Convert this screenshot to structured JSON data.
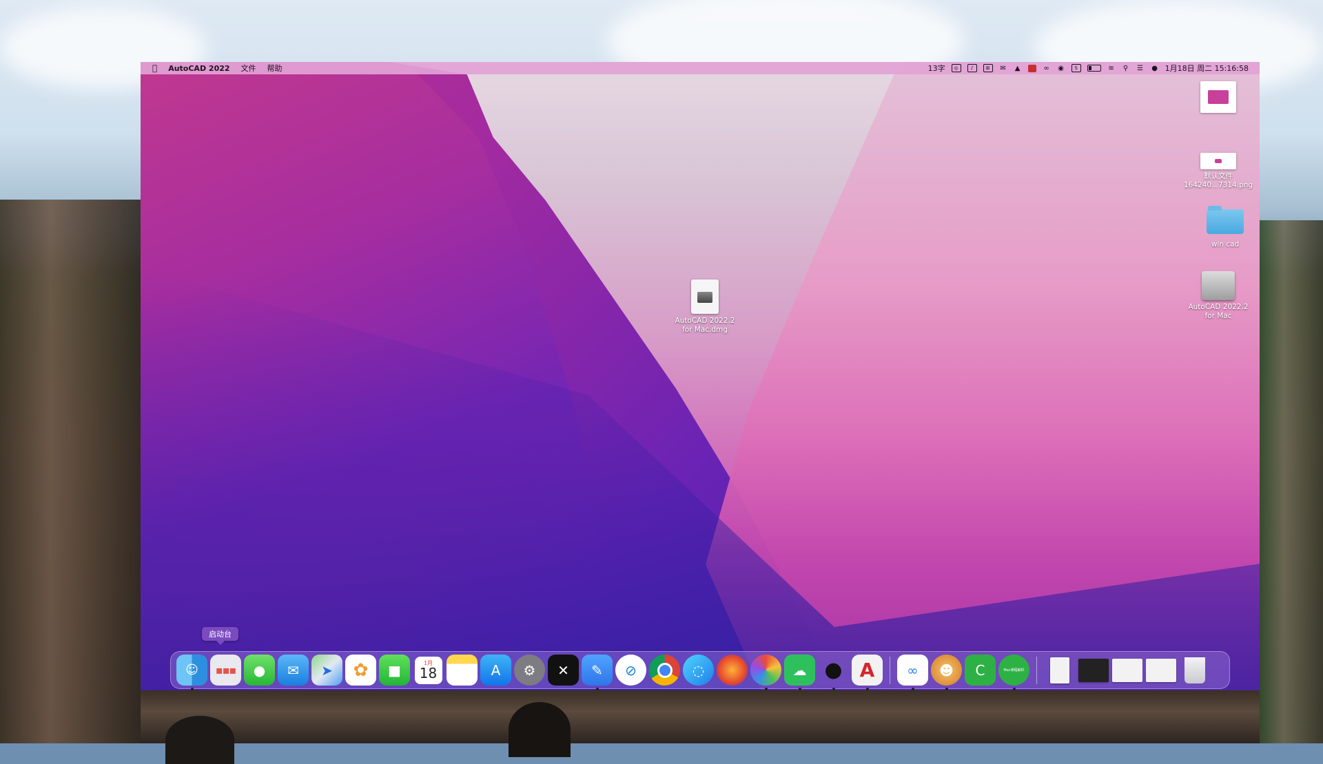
{
  "menubar": {
    "apple": "",
    "app_name": "AutoCAD 2022",
    "menu_file": "文件",
    "menu_help": "帮助",
    "status_text": "13字",
    "datetime": "1月18日 周二 15:16:58"
  },
  "desktop": {
    "icon_screenshot_label": "",
    "icon_png_label": "默认文件\n164240...7314.png",
    "icon_folder_label": "win cad",
    "icon_disk_label": "AutoCAD 2022.2\nfor Mac",
    "icon_dmg_label": "AutoCAD 2022.2\nfor Mac.dmg"
  },
  "dock": {
    "tooltip": "启动台",
    "calendar_month": "1月",
    "calendar_day": "18",
    "apps": [
      "finder-icon",
      "launchpad-icon",
      "messages-icon",
      "mail-icon",
      "maps-icon",
      "photos-icon",
      "facetime-icon",
      "calendar-icon",
      "notes-icon",
      "app-store-icon",
      "system-preferences-icon",
      "capcut-icon",
      "feishu-icon",
      "safari-icon",
      "chrome-icon",
      "qq-browser-icon",
      "firefox-icon",
      "color-wheel-icon",
      "wechat-icon",
      "qq-icon",
      "autocad-icon",
      "baidu-netdisk-icon",
      "monkey-app-icon",
      "camtasia-icon",
      "green-app-icon",
      "downloads-stack-icon",
      "recent-doc-1-icon",
      "recent-doc-2-icon",
      "recent-doc-3-icon",
      "trash-icon"
    ],
    "green_app_label": "Mac课程解析"
  }
}
